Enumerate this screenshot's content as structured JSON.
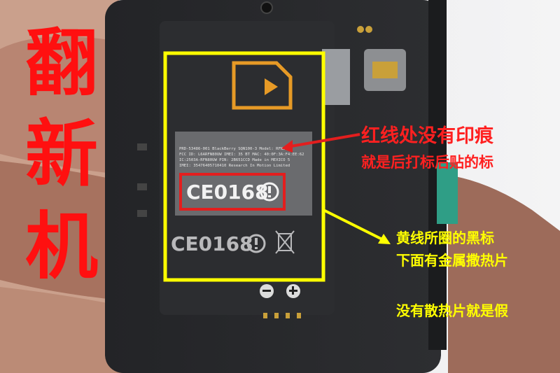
{
  "overlay": {
    "big_characters": [
      "翻",
      "新",
      "机"
    ],
    "red_note": {
      "line1": "红线处没有印痕",
      "line2": "就是后打标后贴的标"
    },
    "yellow_note": {
      "line1": "黄线所圈的黑标",
      "line2": "下面有金属撒热片",
      "line3": "没有散热片就是假"
    }
  },
  "label_text": {
    "ce_mark": "CE0168",
    "ce_mark_small": "CE0168",
    "fine_print": [
      "PRD-53486-001  BlackBerry SQN100-3  Model: RFN81UW",
      "FCC ID: L6ARFN80UW   IMEI: 35   BT MAC: 40:0F:3A:F4:EE:62",
      "IC:2503A-RFN80UW  PIN: 2B651CCD   Made in MEXICO 5",
      "IMEI: 35476405710410             Research In Motion Limited"
    ]
  },
  "colors": {
    "red_annotation": "#ff2020",
    "yellow_annotation": "#ffff00",
    "accent_orange": "#e79a26"
  }
}
